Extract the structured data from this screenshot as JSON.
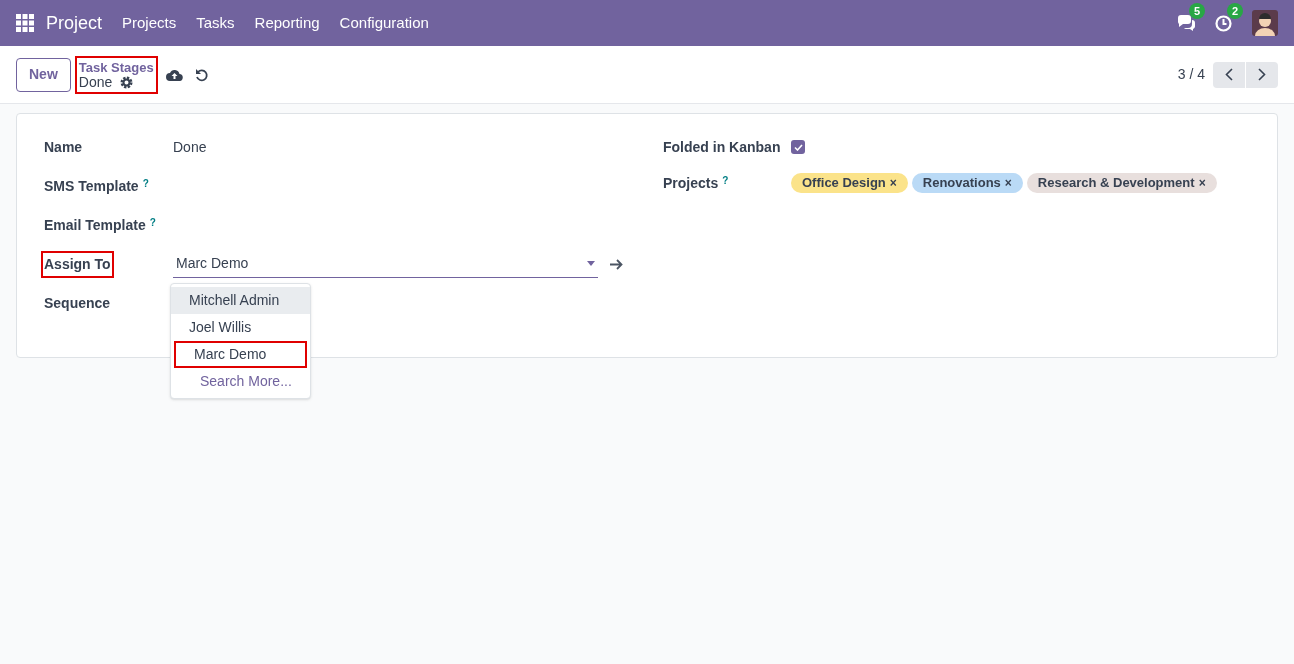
{
  "navbar": {
    "app": "Project",
    "menu": [
      "Projects",
      "Tasks",
      "Reporting",
      "Configuration"
    ],
    "messages_count": "5",
    "activities_count": "2"
  },
  "control_panel": {
    "new_button": "New",
    "breadcrumb": "Task Stages",
    "record": "Done",
    "highlighted": true,
    "pager": "3 / 4"
  },
  "form": {
    "left": [
      {
        "label": "Name",
        "highlighted": false,
        "value": "Done",
        "kind": "text"
      },
      {
        "label": "SMS Template",
        "help": "?",
        "highlighted": false,
        "kind": "empty"
      },
      {
        "label": "Email Template",
        "help": "?",
        "highlighted": false,
        "kind": "empty"
      },
      {
        "label": "Assign To",
        "highlighted": true,
        "value": "Marc Demo",
        "kind": "many2one"
      },
      {
        "label": "Sequence",
        "highlighted": false,
        "kind": "empty"
      }
    ],
    "right": [
      {
        "label": "Folded in Kanban",
        "kind": "checkbox",
        "checked": true
      },
      {
        "label": "Projects",
        "help": "?",
        "kind": "tags",
        "tags": [
          {
            "label": "Office Design",
            "remove": "×",
            "color": "#fbe38a"
          },
          {
            "label": "Renovations",
            "remove": "×",
            "color": "#badaf6"
          },
          {
            "label": "Research & Development",
            "remove": "×",
            "color": "#e8dfdd"
          }
        ]
      }
    ]
  },
  "dropdown": {
    "options": [
      {
        "label": "Mitchell Admin",
        "hovered": true,
        "highlighted": false
      },
      {
        "label": "Joel Willis",
        "hovered": false,
        "highlighted": false
      },
      {
        "label": "Marc Demo",
        "hovered": false,
        "highlighted": true
      }
    ],
    "search_more": "Search More..."
  }
}
